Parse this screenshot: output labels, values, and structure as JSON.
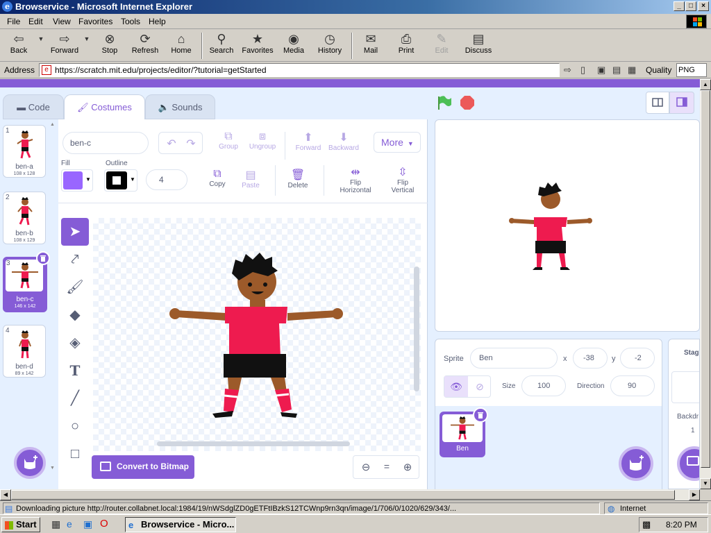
{
  "window": {
    "title": "Browservice - Microsoft Internet Explorer",
    "min": "_",
    "max": "□",
    "close": "×"
  },
  "menu": [
    "File",
    "Edit",
    "View",
    "Favorites",
    "Tools",
    "Help"
  ],
  "toolbar": {
    "back": "Back",
    "forward": "Forward",
    "stop": "Stop",
    "refresh": "Refresh",
    "home": "Home",
    "search": "Search",
    "favorites": "Favorites",
    "media": "Media",
    "history": "History",
    "mail": "Mail",
    "print": "Print",
    "edit": "Edit",
    "discuss": "Discuss"
  },
  "address": {
    "label": "Address",
    "url": "https://scratch.mit.edu/projects/editor/?tutorial=getStarted",
    "quality_label": "Quality",
    "quality_value": "PNG"
  },
  "scratch": {
    "tabs": {
      "code": "Code",
      "costumes": "Costumes",
      "sounds": "Sounds"
    },
    "costumes": [
      {
        "num": "1",
        "name": "ben-a",
        "size": "108 x 128"
      },
      {
        "num": "2",
        "name": "ben-b",
        "size": "108 x 129"
      },
      {
        "num": "3",
        "name": "ben-c",
        "size": "146 x 142"
      },
      {
        "num": "4",
        "name": "ben-d",
        "size": "89 x 142"
      }
    ],
    "paint": {
      "costume_name": "ben-c",
      "group": "Group",
      "ungroup": "Ungroup",
      "forward": "Forward",
      "backward": "Backward",
      "more": "More",
      "fill_label": "Fill",
      "outline_label": "Outline",
      "outline_width": "4",
      "copy": "Copy",
      "paste": "Paste",
      "delete": "Delete",
      "flip_h": "Flip Horizontal",
      "flip_v": "Flip Vertical",
      "convert": "Convert to Bitmap",
      "zoom_reset": "="
    },
    "sprite": {
      "label": "Sprite",
      "name": "Ben",
      "x_label": "x",
      "x": "-38",
      "y_label": "y",
      "y": "-2",
      "size_label": "Size",
      "size": "100",
      "direction_label": "Direction",
      "direction": "90",
      "thumb_name": "Ben"
    },
    "stage": {
      "label": "Stag",
      "backdrops": "Backdr",
      "count": "1"
    }
  },
  "status": {
    "message": "Downloading picture http://router.collabnet.local:1984/19/nWSdglZD0gETFtIBzkS12TCWnp9rn3qn/image/1/706/0/1020/629/343/...",
    "zone": "Internet"
  },
  "taskbar": {
    "start": "Start",
    "task": "Browservice - Micro...",
    "clock": "8:20 PM"
  },
  "colors": {
    "accent": "#855cd6",
    "fill": "#9966ff",
    "jersey": "#ee1b4f",
    "skin": "#9c5a2a",
    "flag": "#4cbf56",
    "stop": "#ec5959"
  }
}
